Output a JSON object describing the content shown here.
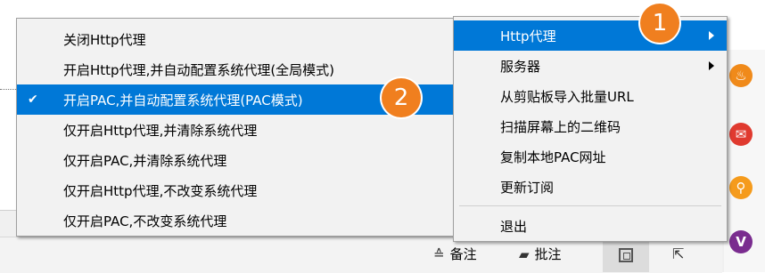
{
  "submenu": {
    "items": [
      {
        "label": "关闭Http代理",
        "checked": false,
        "highlighted": false
      },
      {
        "label": "开启Http代理,并自动配置系统代理(全局模式)",
        "checked": false,
        "highlighted": false
      },
      {
        "label": "开启PAC,并自动配置系统代理(PAC模式)",
        "checked": true,
        "highlighted": true
      },
      {
        "label": "仅开启Http代理,并清除系统代理",
        "checked": false,
        "highlighted": false
      },
      {
        "label": "仅开启PAC,并清除系统代理",
        "checked": false,
        "highlighted": false
      },
      {
        "label": "仅开启Http代理,不改变系统代理",
        "checked": false,
        "highlighted": false
      },
      {
        "label": "仅开启PAC,不改变系统代理",
        "checked": false,
        "highlighted": false
      }
    ],
    "check_glyph": "✔"
  },
  "main_menu": {
    "items": [
      {
        "label": "Http代理",
        "has_submenu": true,
        "highlighted": true
      },
      {
        "label": "服务器",
        "has_submenu": true,
        "highlighted": false
      },
      {
        "label": "从剪贴板导入批量URL",
        "has_submenu": false,
        "highlighted": false
      },
      {
        "label": "扫描屏幕上的二维码",
        "has_submenu": false,
        "highlighted": false
      },
      {
        "label": "复制本地PAC网址",
        "has_submenu": false,
        "highlighted": false
      },
      {
        "label": "更新订阅",
        "has_submenu": false,
        "highlighted": false
      },
      {
        "label": "退出",
        "has_submenu": false,
        "highlighted": false
      }
    ]
  },
  "badges": {
    "one": "1",
    "two": "2",
    "color": "#f07f1f"
  },
  "status_bar": {
    "notes_label": "备注",
    "comments_label": "批注"
  },
  "tray_icons": [
    "fire-icon",
    "mail-icon",
    "search-icon",
    "v-icon"
  ],
  "colors": {
    "highlight": "#0078d7",
    "menu_bg": "#f2f2f2"
  }
}
